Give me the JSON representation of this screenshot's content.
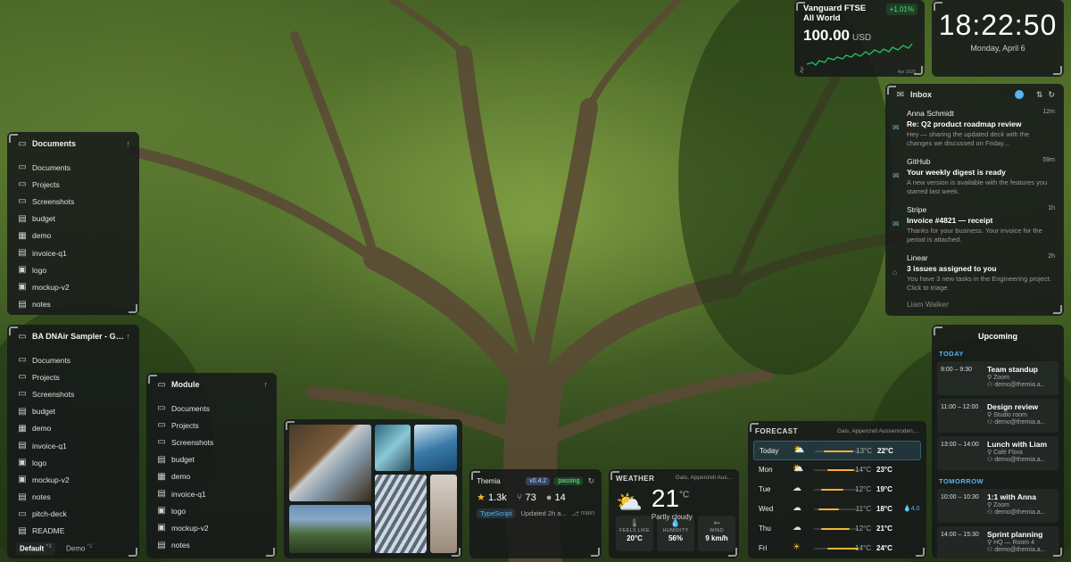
{
  "documents_panel": {
    "title": "Documents",
    "items": [
      {
        "label": "Documents",
        "icon": "folder-icon"
      },
      {
        "label": "Projects",
        "icon": "folder-icon"
      },
      {
        "label": "Screenshots",
        "icon": "folder-icon"
      },
      {
        "label": "budget",
        "icon": "file-icon"
      },
      {
        "label": "demo",
        "icon": "video-icon"
      },
      {
        "label": "invoice-q1",
        "icon": "file-icon"
      },
      {
        "label": "logo",
        "icon": "image-icon"
      },
      {
        "label": "mockup-v2",
        "icon": "image-icon"
      },
      {
        "label": "notes",
        "icon": "file-icon"
      }
    ]
  },
  "sampler_panel": {
    "title": "BA DNAir Sampler - Ge...",
    "items": [
      {
        "label": "Documents",
        "icon": "folder-icon"
      },
      {
        "label": "Projects",
        "icon": "folder-icon"
      },
      {
        "label": "Screenshots",
        "icon": "folder-icon"
      },
      {
        "label": "budget",
        "icon": "file-icon"
      },
      {
        "label": "demo",
        "icon": "video-icon"
      },
      {
        "label": "invoice-q1",
        "icon": "file-icon"
      },
      {
        "label": "logo",
        "icon": "image-icon"
      },
      {
        "label": "mockup-v2",
        "icon": "image-icon"
      },
      {
        "label": "notes",
        "icon": "file-icon"
      },
      {
        "label": "pitch-deck",
        "icon": "presentation-icon"
      },
      {
        "label": "README",
        "icon": "file-icon"
      }
    ],
    "tabs": [
      {
        "label": "Default",
        "key": "1"
      },
      {
        "label": "Demo",
        "key": "2"
      }
    ]
  },
  "module_panel": {
    "title": "Module",
    "items": [
      {
        "label": "Documents",
        "icon": "folder-icon"
      },
      {
        "label": "Projects",
        "icon": "folder-icon"
      },
      {
        "label": "Screenshots",
        "icon": "folder-icon"
      },
      {
        "label": "budget",
        "icon": "file-icon"
      },
      {
        "label": "demo",
        "icon": "video-icon"
      },
      {
        "label": "invoice-q1",
        "icon": "file-icon"
      },
      {
        "label": "logo",
        "icon": "image-icon"
      },
      {
        "label": "mockup-v2",
        "icon": "image-icon"
      },
      {
        "label": "notes",
        "icon": "file-icon"
      }
    ]
  },
  "stock": {
    "name": "Vanguard FTSE All World",
    "change": "+1.01%",
    "price": "100.00",
    "currency": "USD",
    "x_start": "Apr",
    "x_end": "Apr 2026",
    "color": "#22c55e"
  },
  "clock": {
    "time": "18:22:50",
    "date": "Monday, April 6"
  },
  "inbox": {
    "title": "Inbox",
    "messages": [
      {
        "from": "Anna Schmidt",
        "time": "12m",
        "subject": "Re: Q2 product roadmap review",
        "preview": "Hey — sharing the updated deck with the changes we discussed on Friday...",
        "unread": true
      },
      {
        "from": "GitHub",
        "time": "59m",
        "subject": "Your weekly digest is ready",
        "preview": "A new version is available with the features you starred last week.",
        "unread": true
      },
      {
        "from": "Stripe",
        "time": "1h",
        "subject": "Invoice #4821 — receipt",
        "preview": "Thanks for your business. Your invoice for the period is attached.",
        "unread": true
      },
      {
        "from": "Linear",
        "time": "2h",
        "subject": "3 issues assigned to you",
        "preview": "You have 3 new tasks in the Engineering project. Click to triage.",
        "unread": false
      }
    ],
    "next_from": "Liam Walker"
  },
  "upcoming": {
    "title": "Upcoming",
    "today_label": "TODAY",
    "tomorrow_label": "TOMORROW",
    "today": [
      {
        "time": "9:00 – 9:30",
        "name": "Team standup",
        "location": "Zoom",
        "attendee": "demo@themia.a..."
      },
      {
        "time": "11:00 – 12:00",
        "name": "Design review",
        "location": "Studio room",
        "attendee": "demo@themia.a..."
      },
      {
        "time": "13:00 – 14:00",
        "name": "Lunch with Liam",
        "location": "Café Flora",
        "attendee": "demo@themia.a..."
      }
    ],
    "tomorrow": [
      {
        "time": "10:00 – 10:30",
        "name": "1:1 with Anna",
        "location": "Zoom",
        "attendee": "demo@themia.a..."
      },
      {
        "time": "14:00 – 15:30",
        "name": "Sprint planning",
        "location": "HQ — Room 4",
        "attendee": "demo@themia.a..."
      }
    ]
  },
  "repo": {
    "name": "Themia",
    "version": "v0.4.2",
    "status": "passing",
    "stars": "1.3k",
    "forks": "73",
    "issues": "14",
    "language": "TypeScript",
    "updated": "Updated 2h a...",
    "branch": "main"
  },
  "weather": {
    "label": "WEATHER",
    "location": "Gais, Appenzell Aus...",
    "temp": "21",
    "unit": "°C",
    "condition": "Partly cloudy",
    "feels_like_label": "FEELS LIKE",
    "feels_like": "20°C",
    "humidity_label": "HUMIDITY",
    "humidity": "56%",
    "wind_label": "WIND",
    "wind": "9 km/h"
  },
  "forecast": {
    "label": "FORECAST",
    "location": "Gais, Appenzell Aussenroden,...",
    "days": [
      {
        "day": "Today",
        "icon": "partly-cloudy-icon",
        "low": "13°C",
        "high": "22°C",
        "bar_start": 0.2,
        "bar_end": 0.85,
        "precip": ""
      },
      {
        "day": "Mon",
        "icon": "partly-cloudy-icon",
        "low": "14°C",
        "high": "23°C",
        "bar_start": 0.3,
        "bar_end": 0.9,
        "precip": ""
      },
      {
        "day": "Tue",
        "icon": "cloud-icon",
        "low": "12°C",
        "high": "19°C",
        "bar_start": 0.15,
        "bar_end": 0.65,
        "precip": ""
      },
      {
        "day": "Wed",
        "icon": "cloud-icon",
        "low": "11°C",
        "high": "18°C",
        "bar_start": 0.1,
        "bar_end": 0.55,
        "precip": "4.0"
      },
      {
        "day": "Thu",
        "icon": "cloud-icon",
        "low": "12°C",
        "high": "21°C",
        "bar_start": 0.15,
        "bar_end": 0.8,
        "precip": ""
      },
      {
        "day": "Fri",
        "icon": "sun-icon",
        "low": "14°C",
        "high": "24°C",
        "bar_start": 0.3,
        "bar_end": 1.0,
        "precip": ""
      }
    ]
  }
}
